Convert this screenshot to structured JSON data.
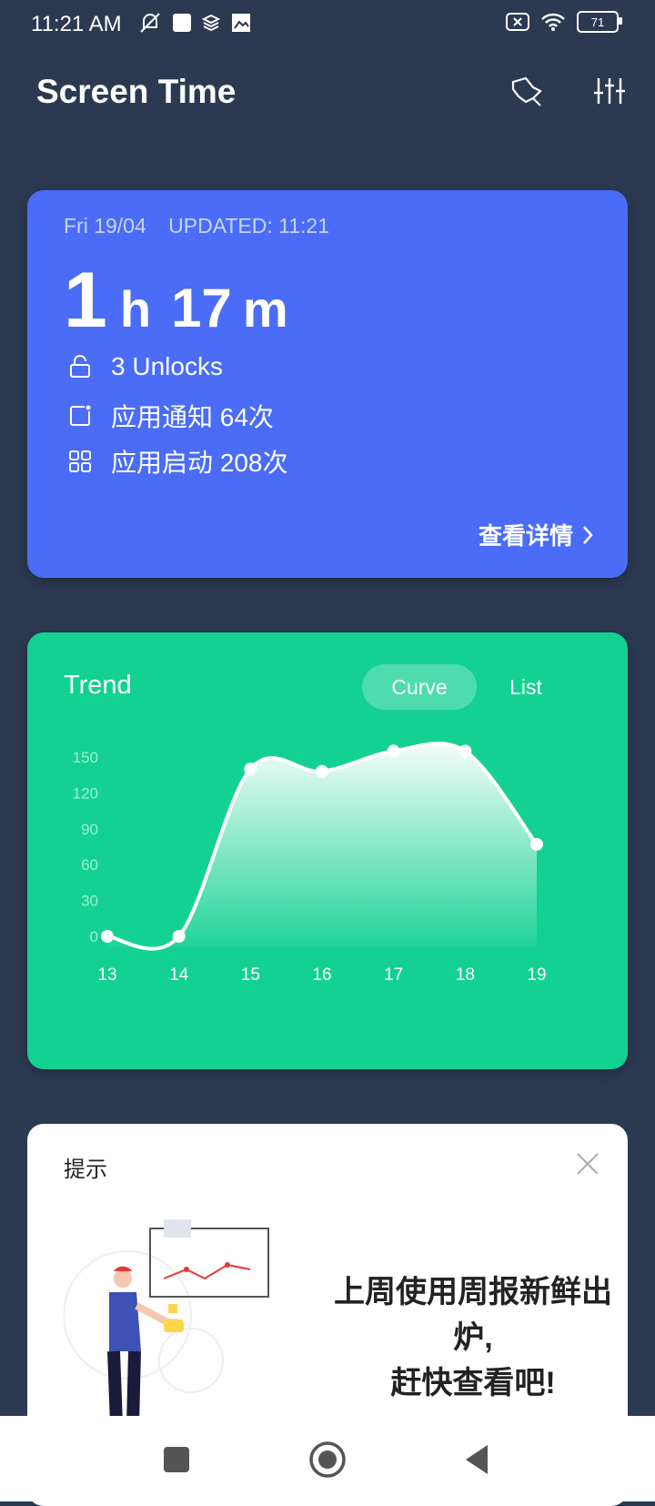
{
  "status_bar": {
    "time": "11:21 AM",
    "battery": "71",
    "icons_left": [
      "mute-icon",
      "square-icon",
      "layers-icon",
      "image-icon"
    ],
    "icons_right": [
      "sim-off-icon",
      "wifi-icon",
      "battery-icon"
    ]
  },
  "appbar": {
    "title": "Screen Time"
  },
  "summary": {
    "date": "Fri 19/04",
    "updated": "UPDATED: 11:21",
    "hours_value": "1",
    "hours_unit": "h",
    "minutes_value": "17",
    "minutes_unit": "m",
    "unlocks": "3 Unlocks",
    "notifications": "应用通知  64次",
    "launches": "应用启动  208次",
    "detail_link": "查看详情"
  },
  "trend": {
    "title": "Trend",
    "toggle_curve": "Curve",
    "toggle_list": "List"
  },
  "chart_data": {
    "type": "area",
    "x": [
      "13",
      "14",
      "15",
      "16",
      "17",
      "18",
      "19"
    ],
    "values": [
      0,
      0,
      140,
      138,
      155,
      155,
      77
    ],
    "y_ticks": [
      "0",
      "30",
      "60",
      "90",
      "120",
      "150"
    ],
    "ylim": [
      0,
      150
    ],
    "title": "",
    "xlabel": "",
    "ylabel": "",
    "grid": false
  },
  "tip": {
    "title": "提示",
    "message_line1": "上周使用周报新鲜出",
    "message_line2": "炉,",
    "message_line3": "赶快查看吧!"
  },
  "colors": {
    "background": "#2b3a51",
    "summary_card": "#4a6cf7",
    "trend_card": "#13d193",
    "tip_card": "#ffffff"
  }
}
